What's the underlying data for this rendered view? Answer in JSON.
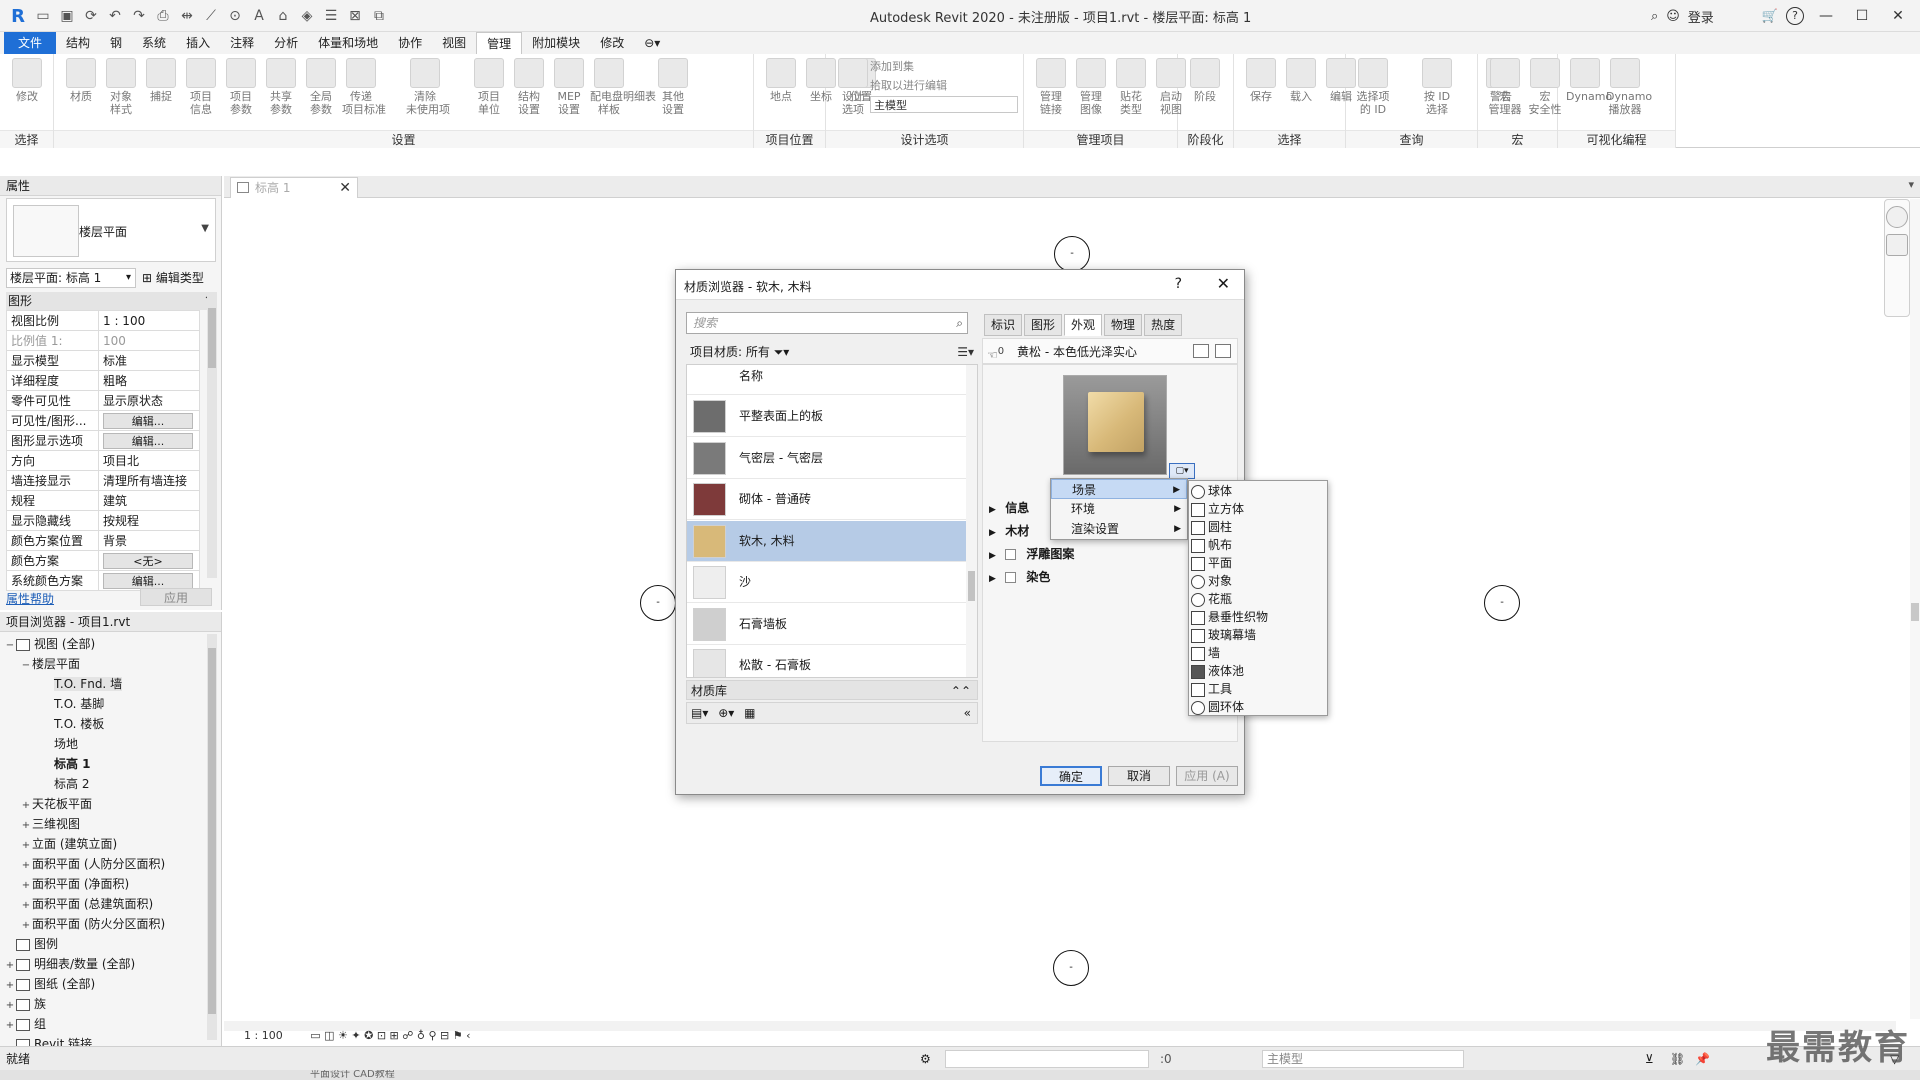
{
  "window": {
    "title": "Autodesk Revit 2020 - 未注册版 - 项目1.rvt - 楼层平面: 标高 1",
    "login_label": "登录",
    "help_label": "?"
  },
  "quick_access": [
    "R",
    "open-icon",
    "save-icon",
    "sync-icon",
    "undo-icon",
    "redo-icon",
    "print-icon",
    "measure-icon",
    "dimension-icon",
    "text-icon",
    "3d-view-icon",
    "section-icon",
    "thin-lines-icon",
    "close-hidden-icon",
    "switch-windows-icon"
  ],
  "menu_tabs": [
    "文件",
    "结构",
    "钢",
    "系统",
    "插入",
    "注释",
    "分析",
    "体量和场地",
    "协作",
    "视图",
    "管理",
    "附加模块",
    "修改"
  ],
  "active_menu_tab": "管理",
  "ribbon": {
    "groups": [
      {
        "title": "选择",
        "buttons": [
          "修改"
        ]
      },
      {
        "title": "设置",
        "buttons": [
          "材质",
          "对象\n样式",
          "捕捉",
          "项目\n信息",
          "项目\n参数",
          "共享\n参数",
          "全局\n参数",
          "传递\n项目标准",
          "清除\n未使用项",
          "项目\n单位",
          "结构\n设置",
          "MEP\n设置",
          "配电盘明细表\n样板",
          "其他\n设置"
        ]
      },
      {
        "title": "项目位置",
        "buttons": [
          "地点",
          "坐标",
          "位置"
        ]
      },
      {
        "title": "设计选项",
        "buttons": [
          "设计\n选项"
        ],
        "extras": [
          "添加到集",
          "拾取以进行编辑",
          "主模型"
        ]
      },
      {
        "title": "管理项目",
        "buttons": [
          "管理\n链接",
          "管理\n图像",
          "贴花\n类型",
          "启动\n视图"
        ]
      },
      {
        "title": "阶段化",
        "buttons": [
          "阶段"
        ]
      },
      {
        "title": "选择",
        "buttons": [
          "保存",
          "载入",
          "编辑"
        ]
      },
      {
        "title": "查询",
        "buttons": [
          "选择项\n的 ID",
          "按 ID\n选择",
          "警告"
        ]
      },
      {
        "title": "宏",
        "buttons": [
          "宏\n管理器",
          "宏\n安全性"
        ]
      },
      {
        "title": "可视化编程",
        "buttons": [
          "Dynamo",
          "Dynamo\n播放器"
        ]
      }
    ]
  },
  "properties": {
    "panel_title": "属性",
    "type_name": "楼层平面",
    "instance_selector": "楼层平面: 标高 1",
    "edit_type_label": "编辑类型",
    "category": "图形",
    "rows": [
      {
        "key": "视图比例",
        "value": "1 : 100"
      },
      {
        "key": "比例值 1:",
        "value": "100",
        "dim": true
      },
      {
        "key": "显示模型",
        "value": "标准"
      },
      {
        "key": "详细程度",
        "value": "粗略"
      },
      {
        "key": "零件可见性",
        "value": "显示原状态"
      },
      {
        "key": "可见性/图形...",
        "value": "编辑...",
        "button": true
      },
      {
        "key": "图形显示选项",
        "value": "编辑...",
        "button": true
      },
      {
        "key": "方向",
        "value": "项目北"
      },
      {
        "key": "墙连接显示",
        "value": "清理所有墙连接"
      },
      {
        "key": "规程",
        "value": "建筑"
      },
      {
        "key": "显示隐藏线",
        "value": "按规程"
      },
      {
        "key": "颜色方案位置",
        "value": "背景"
      },
      {
        "key": "颜色方案",
        "value": "<无>",
        "button": true
      },
      {
        "key": "系统颜色方案",
        "value": "编辑...",
        "button": true
      }
    ],
    "help_link": "属性帮助",
    "apply_label": "应用"
  },
  "project_browser": {
    "title": "项目浏览器 - 项目1.rvt",
    "items": [
      {
        "label": "视图 (全部)",
        "level": 0,
        "toggle": "−",
        "icon": true
      },
      {
        "label": "楼层平面",
        "level": 1,
        "toggle": "−"
      },
      {
        "label": "T.O. Fnd. 墙",
        "level": 2,
        "selected": true
      },
      {
        "label": "T.O. 基脚",
        "level": 2
      },
      {
        "label": "T.O. 楼板",
        "level": 2
      },
      {
        "label": "场地",
        "level": 2
      },
      {
        "label": "标高 1",
        "level": 2,
        "bold": true
      },
      {
        "label": "标高 2",
        "level": 2
      },
      {
        "label": "天花板平面",
        "level": 1,
        "toggle": "+"
      },
      {
        "label": "三维视图",
        "level": 1,
        "toggle": "+"
      },
      {
        "label": "立面 (建筑立面)",
        "level": 1,
        "toggle": "+"
      },
      {
        "label": "面积平面 (人防分区面积)",
        "level": 1,
        "toggle": "+"
      },
      {
        "label": "面积平面 (净面积)",
        "level": 1,
        "toggle": "+"
      },
      {
        "label": "面积平面 (总建筑面积)",
        "level": 1,
        "toggle": "+"
      },
      {
        "label": "面积平面 (防火分区面积)",
        "level": 1,
        "toggle": "+"
      },
      {
        "label": "图例",
        "level": 0,
        "toggle": "",
        "icon": true
      },
      {
        "label": "明细表/数量 (全部)",
        "level": 0,
        "toggle": "+",
        "icon": true
      },
      {
        "label": "图纸 (全部)",
        "level": 0,
        "toggle": "+",
        "icon": true
      },
      {
        "label": "族",
        "level": 0,
        "toggle": "+",
        "icon": true
      },
      {
        "label": "组",
        "level": 0,
        "toggle": "+",
        "icon": true
      },
      {
        "label": "Revit 链接",
        "level": 0,
        "toggle": "",
        "icon": true
      }
    ]
  },
  "document_tab": {
    "label": "标高 1",
    "close": "✕"
  },
  "view_control": {
    "scale": "1 : 100"
  },
  "status_bar": {
    "text": "就绪",
    "coord": ":0",
    "model": "主模型"
  },
  "bottom_strip": "平面设计    CAD教程",
  "watermark": "最需教育",
  "markers": [
    "-",
    "-",
    "-",
    "-"
  ],
  "dialog": {
    "title": "材质浏览器 - 软木, 木料",
    "help": "?",
    "close": "✕",
    "search_placeholder": "搜索",
    "filter_label": "项目材质: 所有",
    "list_header": "名称",
    "materials": [
      {
        "name": "平整表面上的板",
        "color": "#6d6d6d"
      },
      {
        "name": "气密层 - 气密层",
        "color": "#7a7a7a"
      },
      {
        "name": "砌体 - 普通砖",
        "color": "#7e3a3a"
      },
      {
        "name": "软木, 木料",
        "color": "#d8b979",
        "selected": true
      },
      {
        "name": "沙",
        "color": "#eeeeee"
      },
      {
        "name": "石膏墙板",
        "color": "#cfcfcf"
      },
      {
        "name": "松散 - 石膏板",
        "color": "#e6e6e6"
      }
    ],
    "library_label": "材质库",
    "tabs": [
      "标识",
      "图形",
      "外观",
      "物理",
      "热度"
    ],
    "active_tab": "外观",
    "asset_count": "0",
    "asset_name": "黄松 - 本色低光泽实心",
    "sections": [
      {
        "label": "信息",
        "checkbox": false
      },
      {
        "label": "木材",
        "checkbox": false
      },
      {
        "label": "浮雕图案",
        "checkbox": true
      },
      {
        "label": "染色",
        "checkbox": true
      }
    ],
    "buttons": {
      "ok": "确定",
      "cancel": "取消",
      "apply": "应用 (A)"
    }
  },
  "preview_menu": {
    "items": [
      {
        "label": "场景",
        "highlighted": true
      },
      {
        "label": "环境"
      },
      {
        "label": "渲染设置"
      }
    ]
  },
  "scene_submenu": {
    "items": [
      {
        "label": "球体",
        "icon": "sphere-icon"
      },
      {
        "label": "立方体",
        "icon": "cube-icon"
      },
      {
        "label": "圆柱",
        "icon": "cylinder-icon"
      },
      {
        "label": "帆布",
        "icon": "canvas-icon"
      },
      {
        "label": "平面",
        "icon": "plane-icon"
      },
      {
        "label": "对象",
        "icon": "object-icon"
      },
      {
        "label": "花瓶",
        "icon": "vase-icon"
      },
      {
        "label": "悬垂性织物",
        "icon": "draped-fabric-icon"
      },
      {
        "label": "玻璃幕墙",
        "icon": "glass-curtain-wall-icon"
      },
      {
        "label": "墙",
        "icon": "wall-icon"
      },
      {
        "label": "液体池",
        "icon": "pool-icon"
      },
      {
        "label": "工具",
        "icon": "utility-icon"
      },
      {
        "label": "圆环体",
        "icon": "torus-icon"
      }
    ]
  }
}
